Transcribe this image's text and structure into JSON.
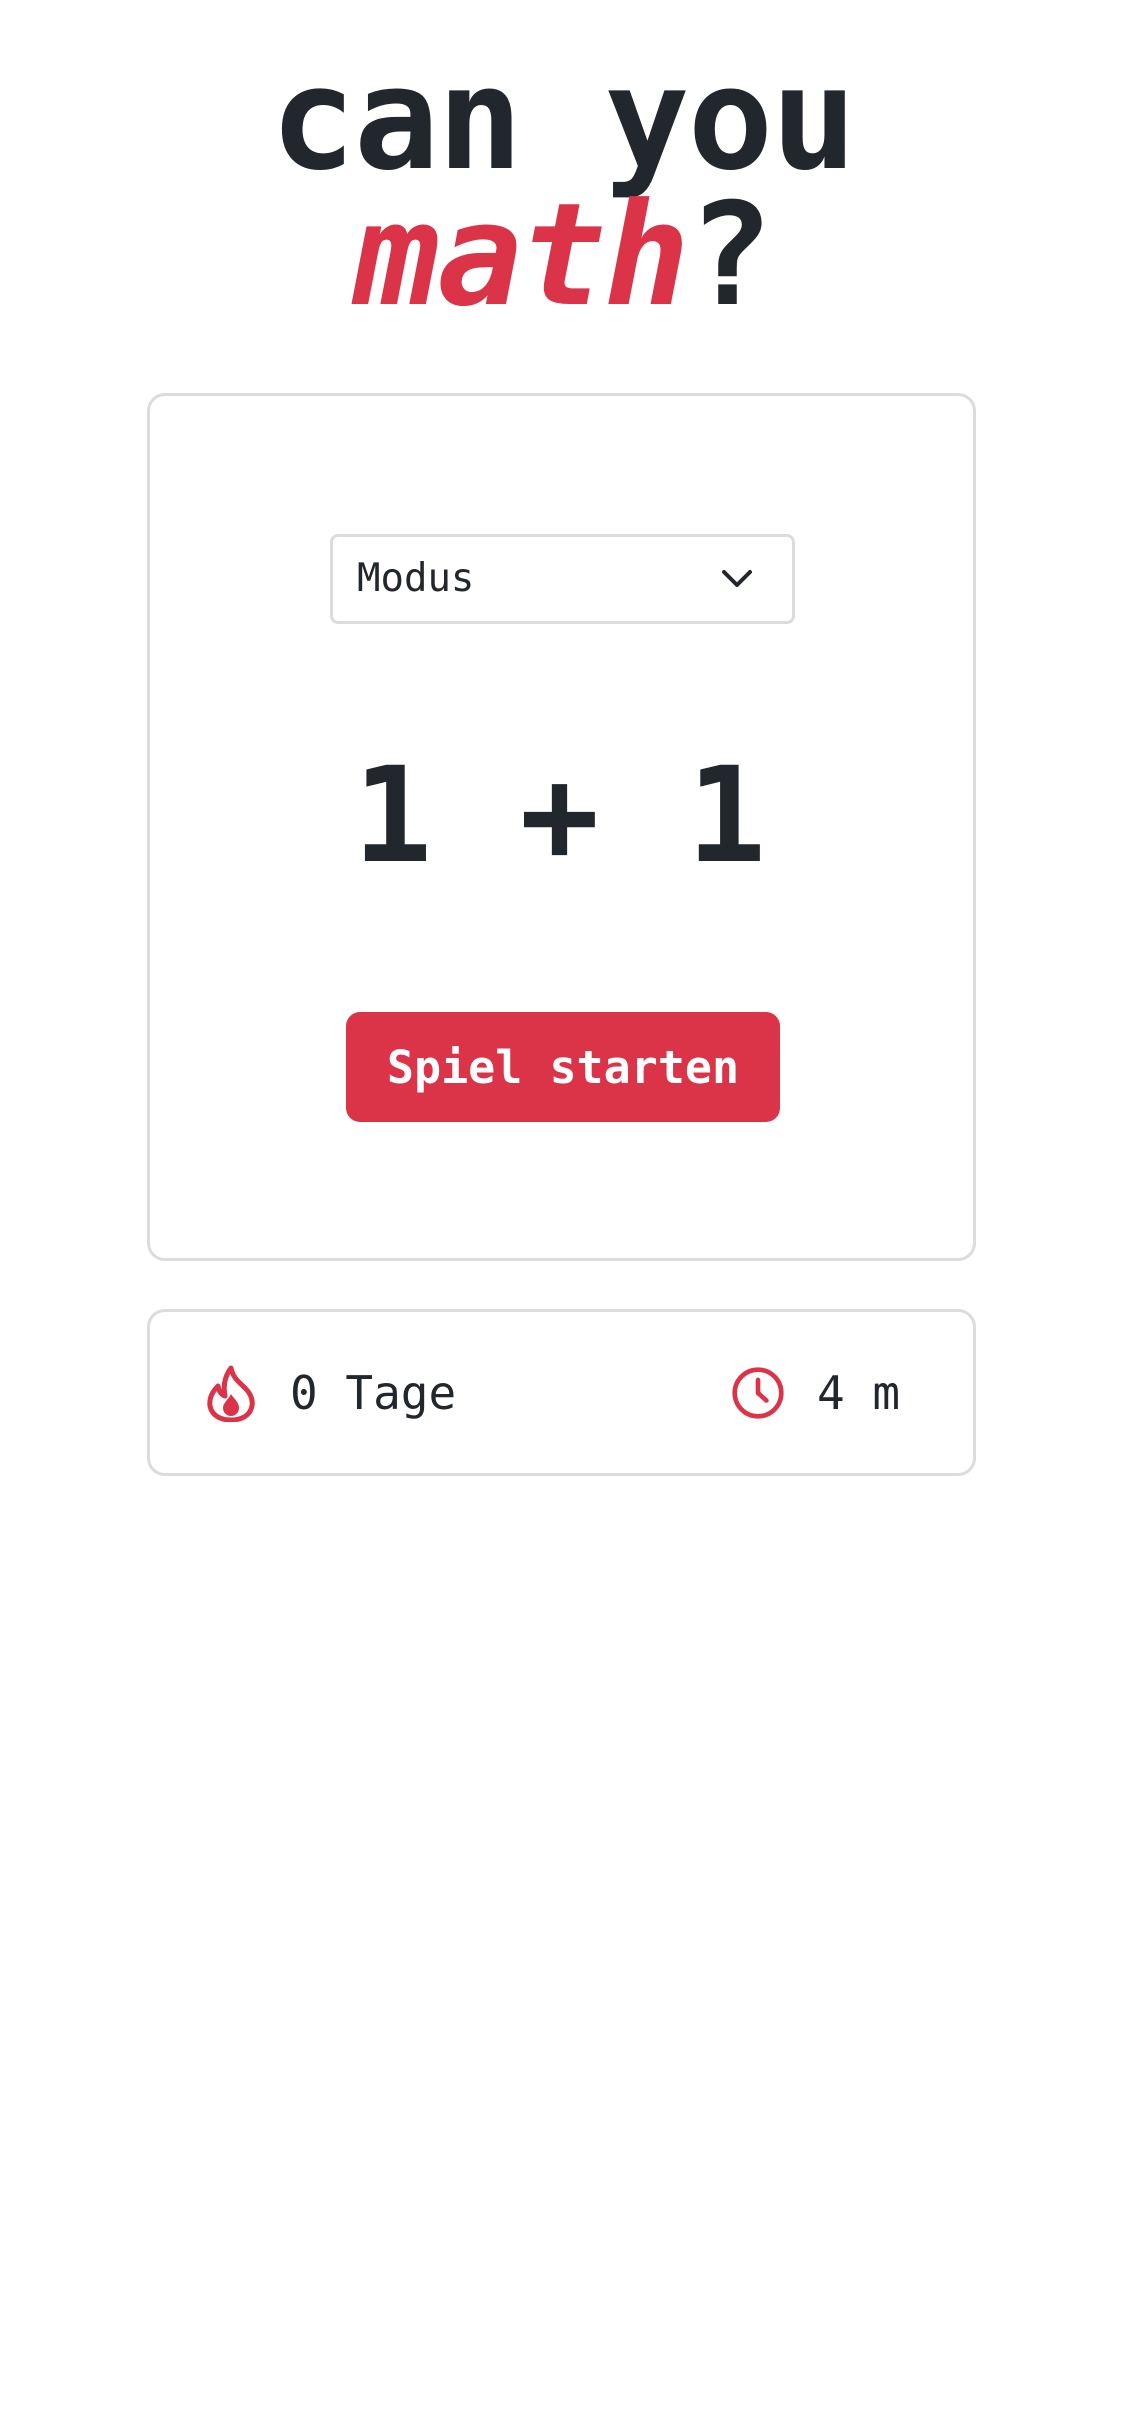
{
  "header": {
    "title_line1": "can you",
    "title_accent": "math",
    "title_suffix": "?"
  },
  "game": {
    "mode_select": {
      "label": "Modus",
      "icon": "chevron-down-icon"
    },
    "problem": "1 + 1",
    "start_button": "Spiel starten"
  },
  "stats": {
    "streak": {
      "icon": "flame-icon",
      "value": "0 Tage"
    },
    "time": {
      "icon": "clock-icon",
      "value": "4 m"
    }
  },
  "colors": {
    "accent": "#db3347",
    "text": "#22262d",
    "border": "#dcdcdc",
    "background": "#ffffff"
  }
}
